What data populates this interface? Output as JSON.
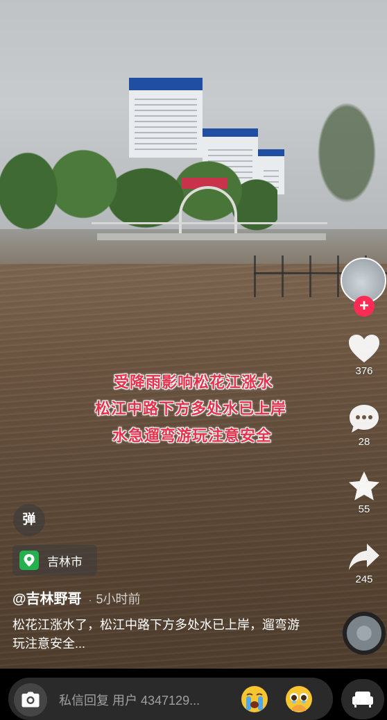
{
  "caption": {
    "line1": "受降雨影响松花江涨水",
    "line2": "松江中路下方多处水已上岸",
    "line3": "水急遛弯游玩注意安全"
  },
  "actions": {
    "likes": "376",
    "comments": "28",
    "favorites": "55",
    "shares": "245",
    "follow_label": "+"
  },
  "danmaku": {
    "label": "弹"
  },
  "location": {
    "city": "吉林市"
  },
  "post": {
    "author": "@吉林野哥",
    "separator": "·",
    "time": "5小时前",
    "description": "松花江涨水了，松江中路下方多处水已上岸，遛弯游玩注意安全..."
  },
  "reply": {
    "placeholder": "私信回复 用户 4347129..."
  },
  "colors": {
    "accent": "#fe2c55",
    "caption": "#e8304a",
    "location_pin": "#22b14c"
  },
  "icons": [
    "heart-icon",
    "comment-icon",
    "star-icon",
    "share-icon",
    "camera-icon",
    "couch-icon",
    "location-pin-icon"
  ]
}
